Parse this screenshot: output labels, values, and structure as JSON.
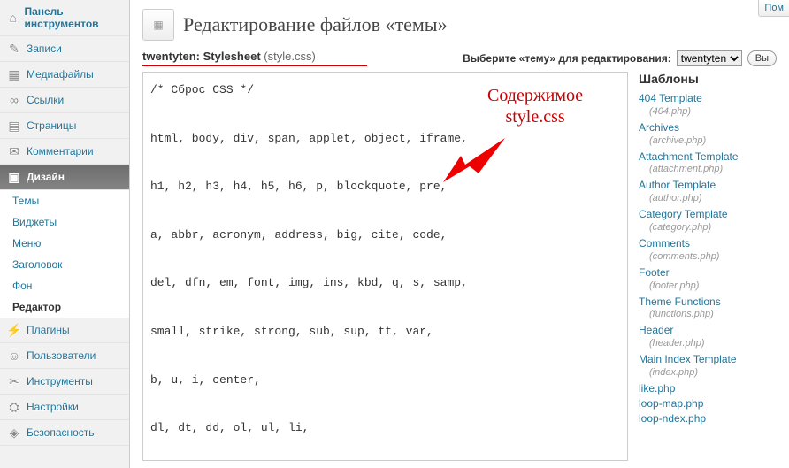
{
  "header": {
    "title": "Редактирование файлов «темы»",
    "help": "Пом"
  },
  "sidebar": {
    "items": [
      {
        "icon": "⌂",
        "label": "Панель инструментов"
      },
      {
        "icon": "📌",
        "label": "Записи"
      },
      {
        "icon": "🖼",
        "label": "Медиафайлы"
      },
      {
        "icon": "🔗",
        "label": "Ссылки"
      },
      {
        "icon": "📄",
        "label": "Страницы"
      },
      {
        "icon": "💬",
        "label": "Комментарии"
      },
      {
        "icon": "🎨",
        "label": "Дизайн"
      },
      {
        "icon": "🔌",
        "label": "Плагины"
      },
      {
        "icon": "👤",
        "label": "Пользователи"
      },
      {
        "icon": "🔧",
        "label": "Инструменты"
      },
      {
        "icon": "⚙",
        "label": "Настройки"
      },
      {
        "icon": "🛡",
        "label": "Безопасность"
      }
    ],
    "design_sub": [
      "Темы",
      "Виджеты",
      "Меню",
      "Заголовок",
      "Фон",
      "Редактор"
    ]
  },
  "file": {
    "theme": "twentyten",
    "label": "Stylesheet",
    "name": "(style.css)"
  },
  "selector": {
    "label": "Выберите «тему» для редактирования:",
    "option": "twentyten",
    "button": "Вы"
  },
  "editor_content": "/* Сброс CSS */\n\nhtml, body, div, span, applet, object, iframe,\n\nh1, h2, h3, h4, h5, h6, p, blockquote, pre,\n\na, abbr, acronym, address, big, cite, code,\n\ndel, dfn, em, font, img, ins, kbd, q, s, samp,\n\nsmall, strike, strong, sub, sup, tt, var,\n\nb, u, i, center,\n\ndl, dt, dd, ol, ul, li,\n\nfieldset, form, label, legend,\n\ntable, caption, tbody, tfoot, thead, tr, th, td {\n\n        background: transparent;\n\n        border: 0;\n\n        margin: 0;\n\n        padding: 0;",
  "templates": {
    "title": "Шаблоны",
    "items": [
      {
        "name": "404 Template",
        "file": "(404.php)"
      },
      {
        "name": "Archives",
        "file": "(archive.php)"
      },
      {
        "name": "Attachment Template",
        "file": "(attachment.php)"
      },
      {
        "name": "Author Template",
        "file": "(author.php)"
      },
      {
        "name": "Category Template",
        "file": "(category.php)"
      },
      {
        "name": "Comments",
        "file": "(comments.php)"
      },
      {
        "name": "Footer",
        "file": "(footer.php)"
      },
      {
        "name": "Theme Functions",
        "file": "(functions.php)"
      },
      {
        "name": "Header",
        "file": "(header.php)"
      },
      {
        "name": "Main Index Template",
        "file": "(index.php)"
      },
      {
        "name": "like.php",
        "file": ""
      },
      {
        "name": "loop-map.php",
        "file": ""
      },
      {
        "name": "loop-ndex.php",
        "file": ""
      }
    ]
  },
  "annotation": {
    "text_line1": "Содержимое",
    "text_line2": "style.css"
  }
}
